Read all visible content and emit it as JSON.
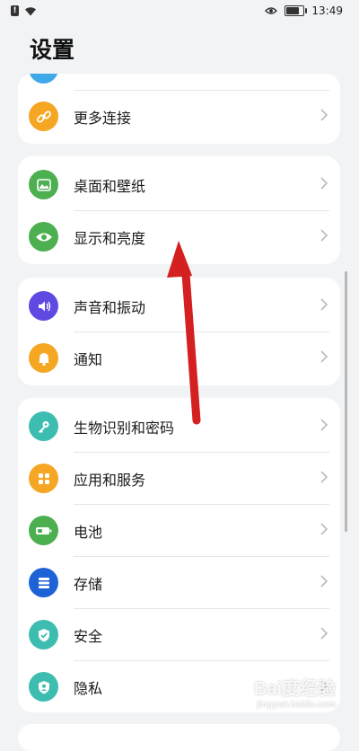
{
  "status_bar": {
    "time": "13:49"
  },
  "page": {
    "title": "设置"
  },
  "groups": [
    {
      "items": [
        {
          "label": "更多连接",
          "icon": "link-icon",
          "color": "#f5a623"
        }
      ]
    },
    {
      "items": [
        {
          "label": "桌面和壁纸",
          "icon": "wallpaper-icon",
          "color": "#4caf50"
        },
        {
          "label": "显示和亮度",
          "icon": "eye-icon",
          "color": "#4caf50"
        }
      ]
    },
    {
      "items": [
        {
          "label": "声音和振动",
          "icon": "speaker-icon",
          "color": "#5e4ae3"
        },
        {
          "label": "通知",
          "icon": "bell-icon",
          "color": "#f5a623"
        }
      ]
    },
    {
      "items": [
        {
          "label": "生物识别和密码",
          "icon": "key-icon",
          "color": "#3dbdb0"
        },
        {
          "label": "应用和服务",
          "icon": "apps-icon",
          "color": "#f5a623"
        },
        {
          "label": "电池",
          "icon": "battery-icon",
          "color": "#4caf50"
        },
        {
          "label": "存储",
          "icon": "storage-icon",
          "color": "#1e63d6"
        },
        {
          "label": "安全",
          "icon": "shield-icon",
          "color": "#3dbdb0"
        },
        {
          "label": "隐私",
          "icon": "privacy-icon",
          "color": "#3dbdb0"
        }
      ]
    }
  ],
  "annotation": {
    "color": "#d42020"
  },
  "watermark": {
    "text": "Bai度经验",
    "subtext": "jingyan.baidu.com"
  }
}
